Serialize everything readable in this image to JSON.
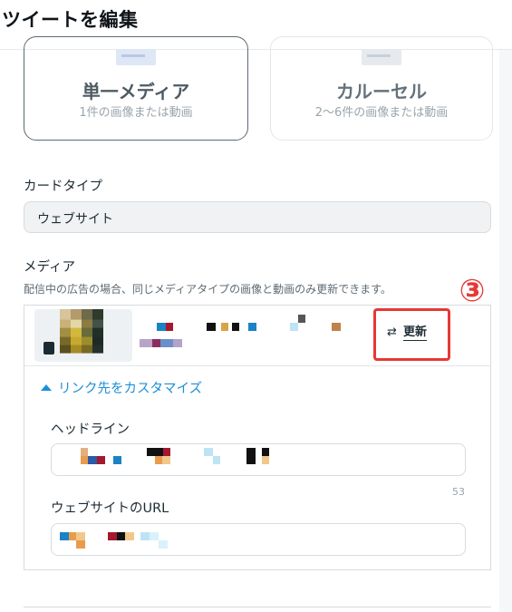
{
  "header": {
    "title": "ツイートを編集"
  },
  "ad_format": {
    "options": [
      {
        "title": "単一メディア",
        "subtitle": "1件の画像または動画",
        "selected": true
      },
      {
        "title": "カルーセル",
        "subtitle": "2〜6件の画像または動画",
        "selected": false
      }
    ]
  },
  "card_type": {
    "label": "カードタイプ",
    "value": "ウェブサイト"
  },
  "media": {
    "label": "メディア",
    "help": "配信中の広告の場合、同じメディアタイプの画像と動画のみ更新できます。",
    "step_marker": "③",
    "update_icon": "⇄",
    "update_label": "更新"
  },
  "customize": {
    "toggle_label": "リンク先をカスタマイズ",
    "headline_label": "ヘッドライン",
    "headline_char_count": "53",
    "url_label": "ウェブサイトのURL"
  },
  "colors": {
    "accent": "#1d8fd6",
    "highlight": "#e53935"
  }
}
